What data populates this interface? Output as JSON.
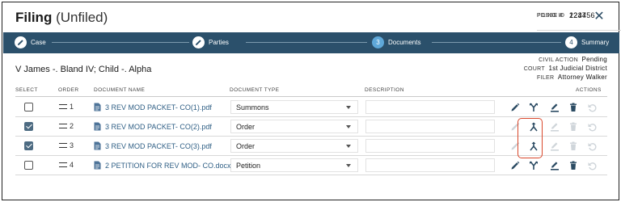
{
  "header": {
    "title": "Filing",
    "subtitle": "(Unfiled)",
    "posse_label": "POSSE #",
    "posse_value": "123456",
    "filing_label": "FILING ID",
    "filing_value": "2247",
    "close_icon": "close-icon"
  },
  "steps": [
    {
      "label": "Case",
      "marker": "pencil-icon",
      "state": "done"
    },
    {
      "label": "Parties",
      "marker": "pencil-icon",
      "state": "done"
    },
    {
      "label": "Documents",
      "number": "3",
      "state": "active"
    },
    {
      "label": "Summary",
      "number": "4",
      "state": "todo"
    }
  ],
  "case": {
    "name": "V James -. Bland IV; Child -. Alpha",
    "civil_action_label": "CIVIL ACTION",
    "civil_action_value": "Pending",
    "court_label": "COURT",
    "court_value": "1st Judicial District",
    "filer_label": "FILER",
    "filer_value": "Attorney Walker"
  },
  "table": {
    "headers": {
      "select": "SELECT",
      "order": "ORDER",
      "document_name": "DOCUMENT NAME",
      "document_type": "DOCUMENT TYPE",
      "description": "DESCRIPTION",
      "actions": "ACTIONS"
    },
    "rows": [
      {
        "checked": false,
        "order": "1",
        "name": "3 REV MOD PACKET- CO(1).pdf",
        "type": "Summons",
        "description": "",
        "actions_enabled": true
      },
      {
        "checked": true,
        "order": "2",
        "name": "3 REV MOD PACKET- CO(2).pdf",
        "type": "Order",
        "description": "",
        "actions_enabled": false
      },
      {
        "checked": true,
        "order": "3",
        "name": "3 REV MOD PACKET- CO(3).pdf",
        "type": "Order",
        "description": "",
        "actions_enabled": false
      },
      {
        "checked": false,
        "order": "4",
        "name": "2 PETITION FOR REV MOD- CO.docx",
        "type": "Petition",
        "description": "",
        "actions_enabled": true
      }
    ]
  },
  "colors": {
    "stepbar": "#2b506b",
    "active_step": "#5fa8d9",
    "link": "#2f5f85",
    "highlight": "#d9472b"
  }
}
